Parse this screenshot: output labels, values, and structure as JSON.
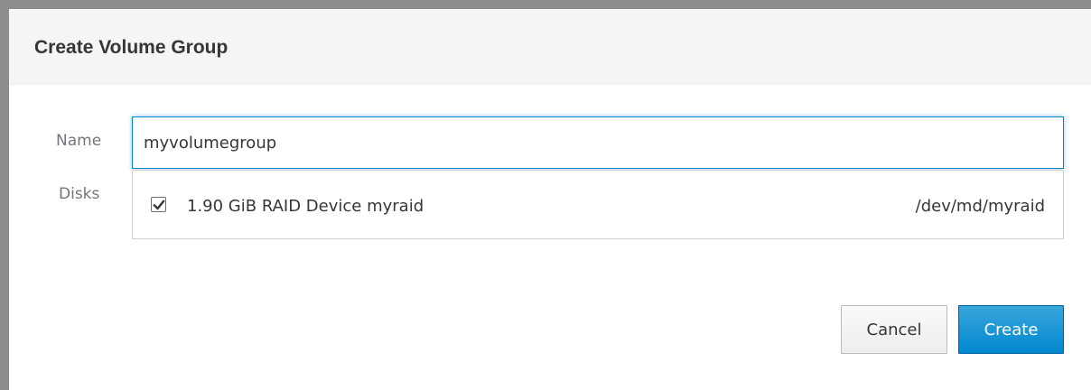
{
  "dialog": {
    "title": "Create Volume Group"
  },
  "form": {
    "name_label": "Name",
    "name_value": "myvolumegroup",
    "disks_label": "Disks"
  },
  "disks": [
    {
      "label": "1.90 GiB RAID Device myraid",
      "path": "/dev/md/myraid",
      "checked": true
    }
  ],
  "buttons": {
    "cancel": "Cancel",
    "create": "Create"
  },
  "colors": {
    "accent": "#0088ce",
    "header_bg": "#f5f5f5",
    "label_text": "#72767b",
    "text": "#363636"
  },
  "icons": {
    "checkbox": "checkmark-icon"
  }
}
